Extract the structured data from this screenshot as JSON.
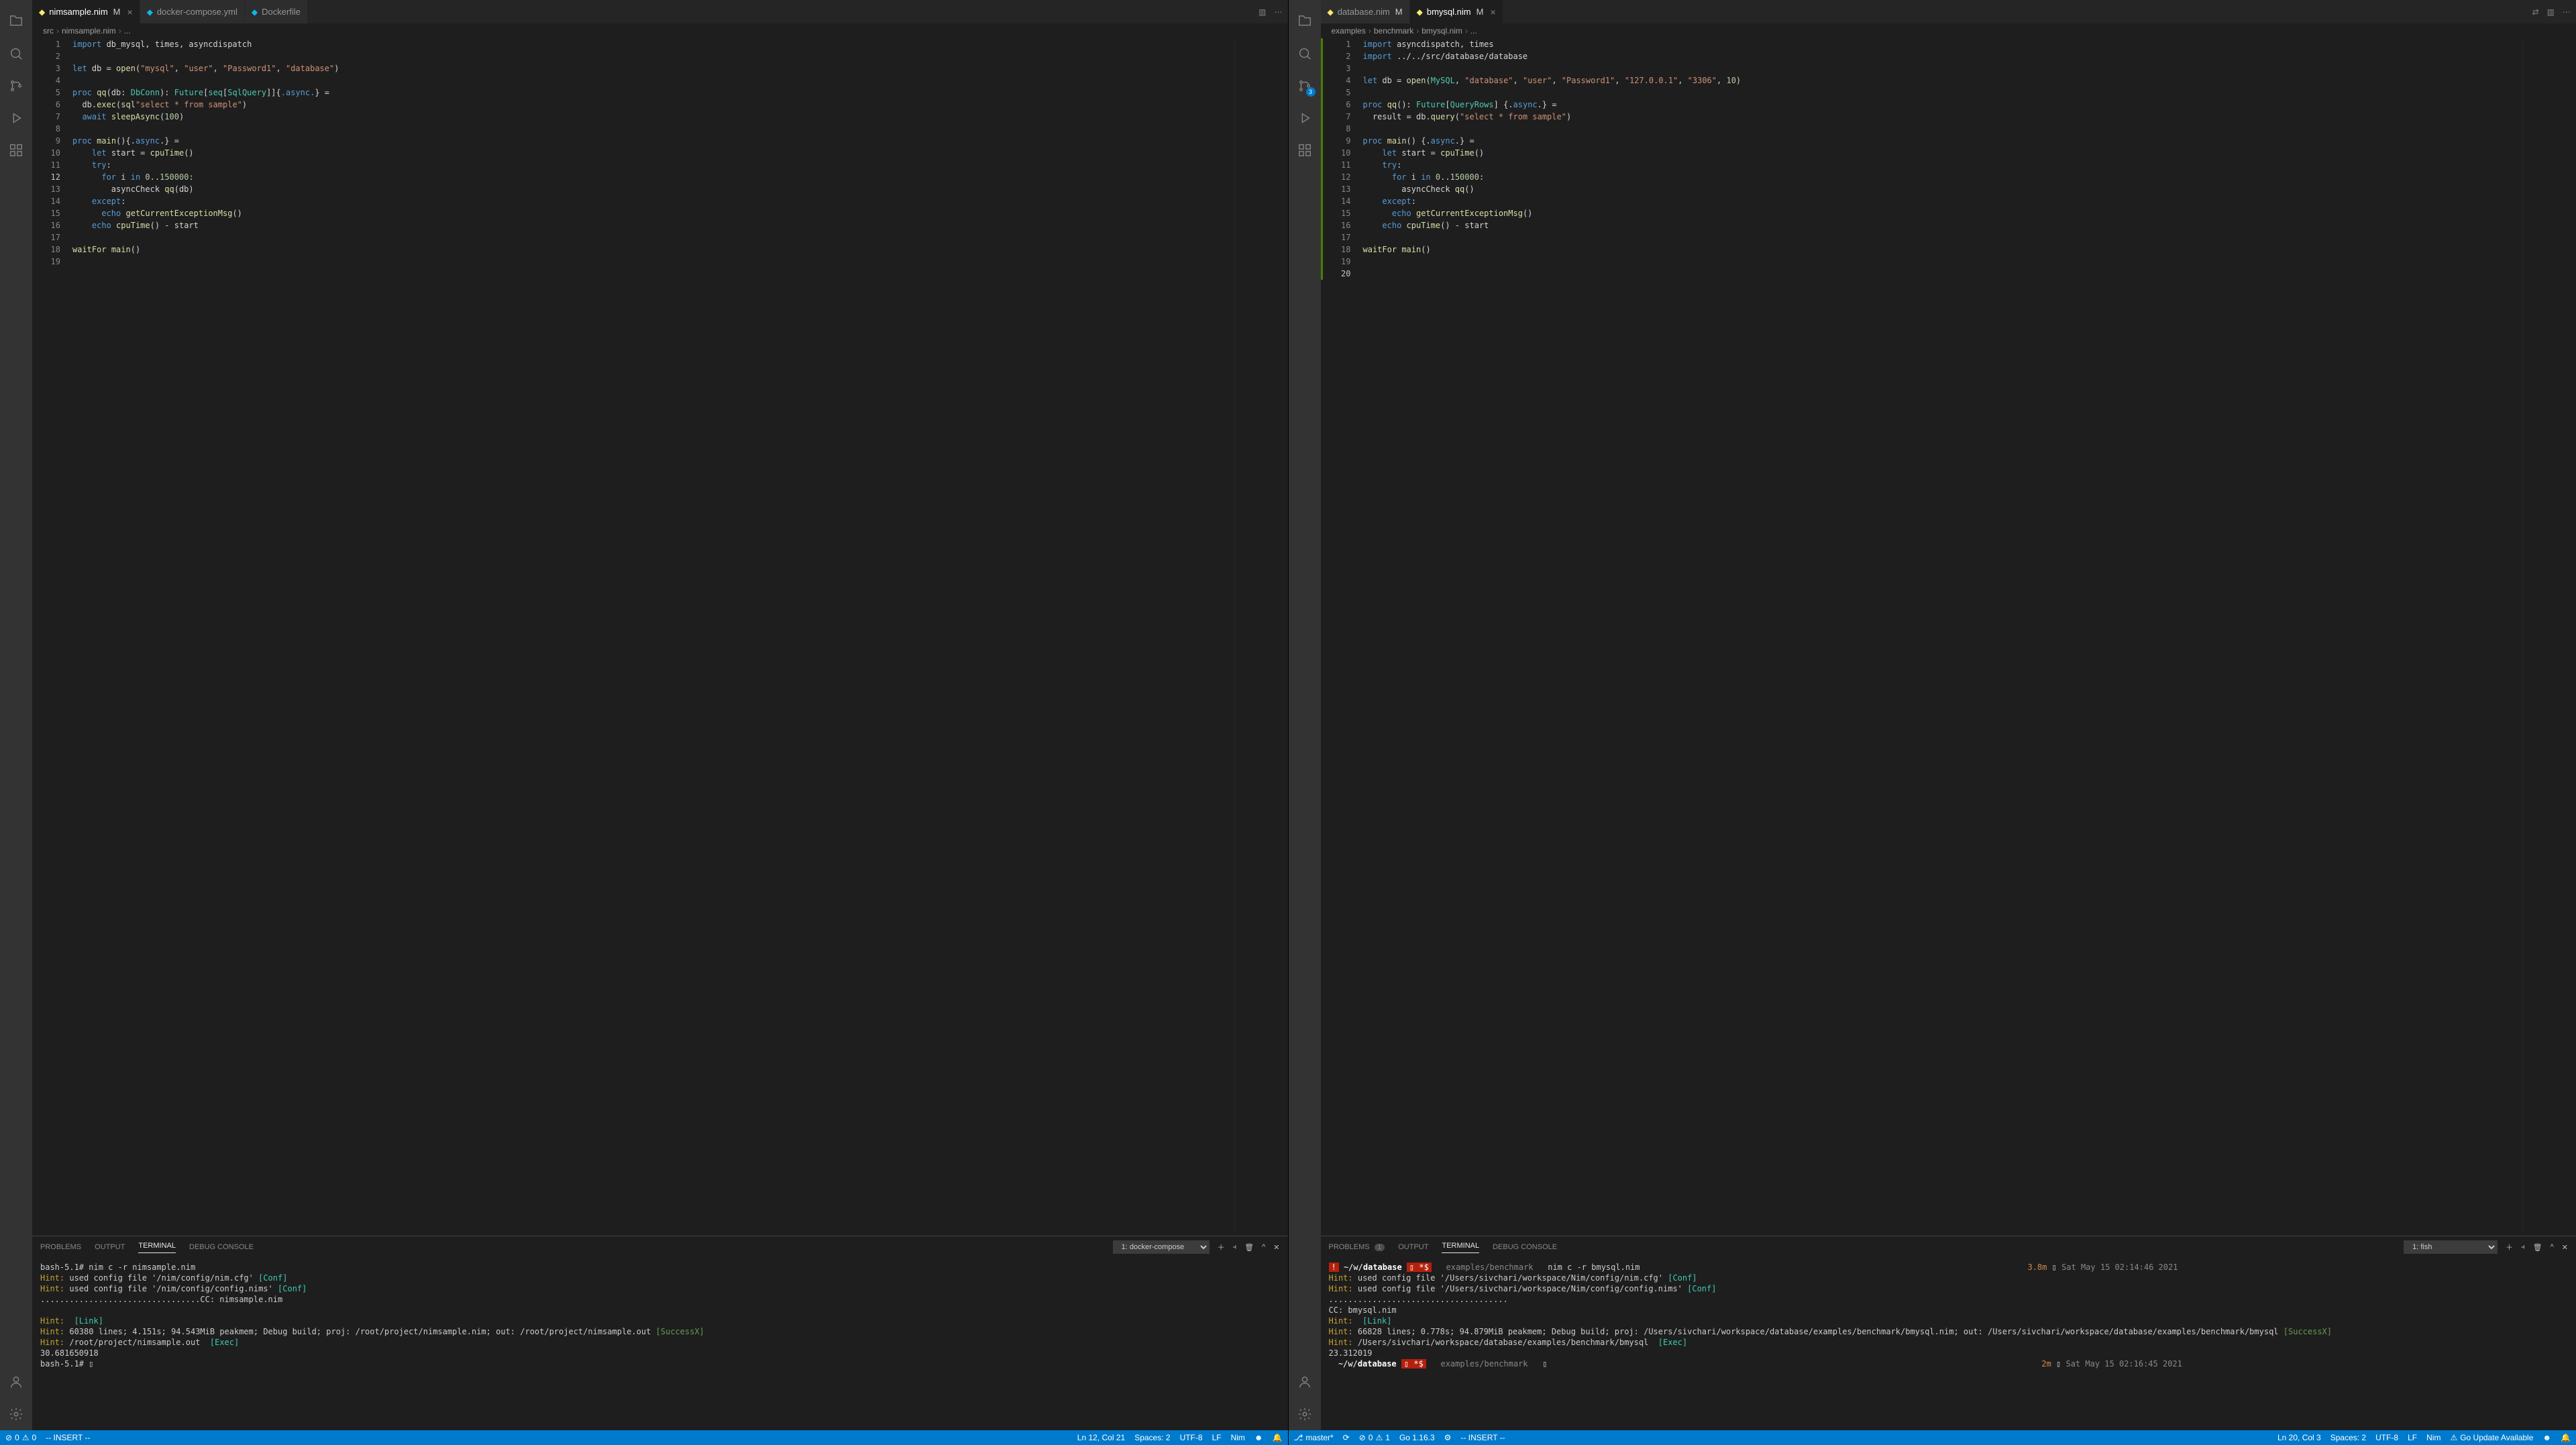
{
  "left": {
    "tabs": [
      {
        "name": "nimsample.nim",
        "modified": "M",
        "active": true
      },
      {
        "name": "docker-compose.yml",
        "modified": "",
        "active": false
      },
      {
        "name": "Dockerfile",
        "modified": "",
        "active": false
      }
    ],
    "breadcrumb": [
      "src",
      "nimsample.nim",
      "..."
    ],
    "lines": 19,
    "current_line": 12,
    "code": [
      [
        [
          "kw",
          "import"
        ],
        [
          "op",
          " db_mysql, times, asyncdispatch"
        ]
      ],
      [],
      [
        [
          "kw",
          "let"
        ],
        [
          "op",
          " db = "
        ],
        [
          "fn",
          "open"
        ],
        [
          "op",
          "("
        ],
        [
          "st",
          "\"mysql\""
        ],
        [
          "op",
          ", "
        ],
        [
          "st",
          "\"user\""
        ],
        [
          "op",
          ", "
        ],
        [
          "st",
          "\"Password1\""
        ],
        [
          "op",
          ", "
        ],
        [
          "st",
          "\"database\""
        ],
        [
          "op",
          ")"
        ]
      ],
      [],
      [
        [
          "kw",
          "proc"
        ],
        [
          "op",
          " "
        ],
        [
          "fn",
          "qq"
        ],
        [
          "op",
          "(db: "
        ],
        [
          "ty",
          "DbConn"
        ],
        [
          "op",
          "): "
        ],
        [
          "ty",
          "Future"
        ],
        [
          "op",
          "["
        ],
        [
          "ty",
          "seq"
        ],
        [
          "op",
          "["
        ],
        [
          "ty",
          "SqlQuery"
        ],
        [
          "op",
          "]]{"
        ],
        [
          "kw",
          ".async."
        ],
        [
          "op",
          "} ="
        ]
      ],
      [
        [
          "op",
          "  db."
        ],
        [
          "fn",
          "exec"
        ],
        [
          "op",
          "("
        ],
        [
          "fn",
          "sql"
        ],
        [
          "st",
          "\"select * from sample\""
        ],
        [
          "op",
          ")"
        ]
      ],
      [
        [
          "op",
          "  "
        ],
        [
          "kw",
          "await"
        ],
        [
          "op",
          " "
        ],
        [
          "fn",
          "sleepAsync"
        ],
        [
          "op",
          "("
        ],
        [
          "nu",
          "100"
        ],
        [
          "op",
          ")"
        ]
      ],
      [],
      [
        [
          "kw",
          "proc"
        ],
        [
          "op",
          " "
        ],
        [
          "fn",
          "main"
        ],
        [
          "op",
          "(){."
        ],
        [
          "kw",
          "async"
        ],
        [
          "op",
          ".} ="
        ]
      ],
      [
        [
          "op",
          "    "
        ],
        [
          "kw",
          "let"
        ],
        [
          "op",
          " start = "
        ],
        [
          "fn",
          "cpuTime"
        ],
        [
          "op",
          "()"
        ]
      ],
      [
        [
          "op",
          "    "
        ],
        [
          "kw",
          "try"
        ],
        [
          "op",
          ":"
        ]
      ],
      [
        [
          "op",
          "      "
        ],
        [
          "kw",
          "for"
        ],
        [
          "op",
          " i "
        ],
        [
          "kw",
          "in"
        ],
        [
          "op",
          " "
        ],
        [
          "nu",
          "0"
        ],
        [
          "op",
          ".."
        ],
        [
          "nu",
          "150000"
        ],
        [
          "op",
          ":"
        ]
      ],
      [
        [
          "op",
          "        asyncCheck "
        ],
        [
          "fn",
          "qq"
        ],
        [
          "op",
          "(db)"
        ]
      ],
      [
        [
          "op",
          "    "
        ],
        [
          "kw",
          "except"
        ],
        [
          "op",
          ":"
        ]
      ],
      [
        [
          "op",
          "      "
        ],
        [
          "kw",
          "echo"
        ],
        [
          "op",
          " "
        ],
        [
          "fn",
          "getCurrentExceptionMsg"
        ],
        [
          "op",
          "()"
        ]
      ],
      [
        [
          "op",
          "    "
        ],
        [
          "kw",
          "echo"
        ],
        [
          "op",
          " "
        ],
        [
          "fn",
          "cpuTime"
        ],
        [
          "op",
          "() - start"
        ]
      ],
      [],
      [
        [
          "fn",
          "waitFor"
        ],
        [
          "op",
          " "
        ],
        [
          "fn",
          "main"
        ],
        [
          "op",
          "()"
        ]
      ],
      []
    ],
    "panel": {
      "tabs": [
        "PROBLEMS",
        "OUTPUT",
        "TERMINAL",
        "DEBUG CONSOLE"
      ],
      "active_tab": "TERMINAL",
      "select": "1: docker-compose",
      "terminal_html": "bash-5.1# nim c -r nimsample.nim\n<span class='t-yellow'>Hint:</span> used config file '/nim/config/nim.cfg' <span class='t-cyan'>[Conf]</span>\n<span class='t-yellow'>Hint:</span> used config file '/nim/config/config.nims' <span class='t-cyan'>[Conf]</span>\n.................................CC: nimsample.nim\n\n<span class='t-yellow'>Hint:</span>  <span class='t-cyan'>[Link]</span>\n<span class='t-yellow'>Hint:</span> 60380 lines; 4.151s; 94.543MiB peakmem; Debug build; proj: /root/project/nimsample.nim; out: /root/project/nimsample.out <span class='t-green'>[SuccessX]</span>\n<span class='t-yellow'>Hint:</span> /root/project/nimsample.out  <span class='t-cyan'>[Exec]</span>\n30.681650918\nbash-5.1# ▯"
    },
    "status": {
      "errors": "0",
      "warnings": "0",
      "mode": "-- INSERT --",
      "pos": "Ln 12, Col 21",
      "spaces": "Spaces: 2",
      "enc": "UTF-8",
      "eol": "LF",
      "lang": "Nim"
    },
    "scm_badge": ""
  },
  "right": {
    "tabs": [
      {
        "name": "database.nim",
        "modified": "M",
        "active": false
      },
      {
        "name": "bmysql.nim",
        "modified": "M",
        "active": true
      }
    ],
    "breadcrumb": [
      "examples",
      "benchmark",
      "bmysql.nim",
      "..."
    ],
    "lines": 20,
    "current_line": 20,
    "code": [
      [
        [
          "kw",
          "import"
        ],
        [
          "op",
          " asyncdispatch, times"
        ]
      ],
      [
        [
          "kw",
          "import"
        ],
        [
          "op",
          " ../../src/database/database"
        ]
      ],
      [],
      [
        [
          "kw",
          "let"
        ],
        [
          "op",
          " db = "
        ],
        [
          "fn",
          "open"
        ],
        [
          "op",
          "("
        ],
        [
          "ty",
          "MySQL"
        ],
        [
          "op",
          ", "
        ],
        [
          "st",
          "\"database\""
        ],
        [
          "op",
          ", "
        ],
        [
          "st",
          "\"user\""
        ],
        [
          "op",
          ", "
        ],
        [
          "st",
          "\"Password1\""
        ],
        [
          "op",
          ", "
        ],
        [
          "st",
          "\"127.0.0.1\""
        ],
        [
          "op",
          ", "
        ],
        [
          "st",
          "\"3306\""
        ],
        [
          "op",
          ", "
        ],
        [
          "nu",
          "10"
        ],
        [
          "op",
          ")"
        ]
      ],
      [],
      [
        [
          "kw",
          "proc"
        ],
        [
          "op",
          " "
        ],
        [
          "fn",
          "qq"
        ],
        [
          "op",
          "(): "
        ],
        [
          "ty",
          "Future"
        ],
        [
          "op",
          "["
        ],
        [
          "ty",
          "QueryRows"
        ],
        [
          "op",
          "] {."
        ],
        [
          "kw",
          "async"
        ],
        [
          "op",
          ".} ="
        ]
      ],
      [
        [
          "op",
          "  result = db."
        ],
        [
          "fn",
          "query"
        ],
        [
          "op",
          "("
        ],
        [
          "st",
          "\"select * from sample\""
        ],
        [
          "op",
          ")"
        ]
      ],
      [],
      [
        [
          "kw",
          "proc"
        ],
        [
          "op",
          " "
        ],
        [
          "fn",
          "main"
        ],
        [
          "op",
          "() {."
        ],
        [
          "kw",
          "async"
        ],
        [
          "op",
          ".} ="
        ]
      ],
      [
        [
          "op",
          "    "
        ],
        [
          "kw",
          "let"
        ],
        [
          "op",
          " start = "
        ],
        [
          "fn",
          "cpuTime"
        ],
        [
          "op",
          "()"
        ]
      ],
      [
        [
          "op",
          "    "
        ],
        [
          "kw",
          "try"
        ],
        [
          "op",
          ":"
        ]
      ],
      [
        [
          "op",
          "      "
        ],
        [
          "kw",
          "for"
        ],
        [
          "op",
          " i "
        ],
        [
          "kw",
          "in"
        ],
        [
          "op",
          " "
        ],
        [
          "nu",
          "0"
        ],
        [
          "op",
          ".."
        ],
        [
          "nu",
          "150000"
        ],
        [
          "op",
          ":"
        ]
      ],
      [
        [
          "op",
          "        asyncCheck "
        ],
        [
          "fn",
          "qq"
        ],
        [
          "op",
          "()"
        ]
      ],
      [
        [
          "op",
          "    "
        ],
        [
          "kw",
          "except"
        ],
        [
          "op",
          ":"
        ]
      ],
      [
        [
          "op",
          "      "
        ],
        [
          "kw",
          "echo"
        ],
        [
          "op",
          " "
        ],
        [
          "fn",
          "getCurrentExceptionMsg"
        ],
        [
          "op",
          "()"
        ]
      ],
      [
        [
          "op",
          "    "
        ],
        [
          "kw",
          "echo"
        ],
        [
          "op",
          " "
        ],
        [
          "fn",
          "cpuTime"
        ],
        [
          "op",
          "() - start"
        ]
      ],
      [],
      [
        [
          "fn",
          "waitFor"
        ],
        [
          "op",
          " "
        ],
        [
          "fn",
          "main"
        ],
        [
          "op",
          "()"
        ]
      ],
      [],
      []
    ],
    "panel": {
      "tabs": [
        "PROBLEMS",
        "OUTPUT",
        "TERMINAL",
        "DEBUG CONSOLE"
      ],
      "active_tab": "TERMINAL",
      "problems_count": "1",
      "select": "1: fish",
      "terminal_html": "<span class='t-red-bg'>!</span> <span class='prompt-path'>~/w/<b>database</b></span> <span class='t-red-bg'>▯ *$</span>   <span class='t-dim'>examples/benchmark</span>   nim c -r bmysql.nim                                                                                <span class='t-orange'>3.8m</span> ▯ <span class='t-dim'>Sat May 15 02:14:46 2021</span>\n<span class='t-yellow'>Hint:</span> used config file '/Users/sivchari/workspace/Nim/config/nim.cfg' <span class='t-cyan'>[Conf]</span>\n<span class='t-yellow'>Hint:</span> used config file '/Users/sivchari/workspace/Nim/config/config.nims' <span class='t-cyan'>[Conf]</span>\n.....................................\nCC: bmysql.nim\n<span class='t-yellow'>Hint:</span>  <span class='t-cyan'>[Link]</span>\n<span class='t-yellow'>Hint:</span> 66828 lines; 0.778s; 94.879MiB peakmem; Debug build; proj: /Users/sivchari/workspace/database/examples/benchmark/bmysql.nim; out: /Users/sivchari/workspace/database/examples/benchmark/bmysql <span class='t-green'>[SuccessX]</span>\n<span class='t-yellow'>Hint:</span> /Users/sivchari/workspace/database/examples/benchmark/bmysql  <span class='t-cyan'>[Exec]</span>\n23.312019\n  <span class='prompt-path'>~/w/<b>database</b></span> <span class='t-red-bg'>▯ *$</span>   <span class='t-dim'>examples/benchmark</span>   ▯                                                                                                      <span class='t-orange'>2m</span> ▯ <span class='t-dim'>Sat May 15 02:16:45 2021</span>"
    },
    "status": {
      "branch": "master*",
      "errors": "0",
      "warnings": "1",
      "go": "Go 1.16.3",
      "mode": "-- INSERT --",
      "pos": "Ln 20, Col 3",
      "spaces": "Spaces: 2",
      "enc": "UTF-8",
      "eol": "LF",
      "lang": "Nim",
      "update": "Go Update Available"
    },
    "scm_badge": "3"
  }
}
